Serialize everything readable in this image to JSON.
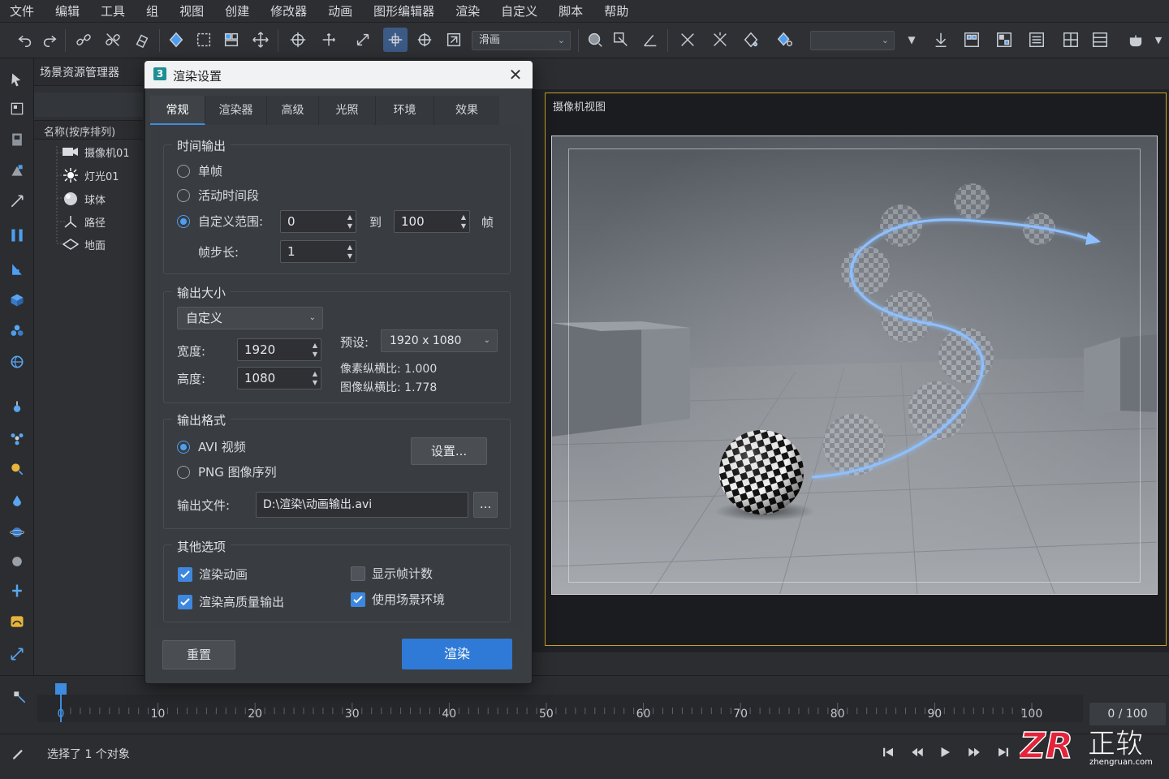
{
  "menu": [
    "文件",
    "编辑",
    "工具",
    "组",
    "视图",
    "创建",
    "修改器",
    "动画",
    "图形编辑器",
    "渲染",
    "自定义",
    "脚本",
    "帮助"
  ],
  "toolbar": {
    "mode_select": "滑画",
    "empty_select": ""
  },
  "scene_explorer": {
    "title": "场景资源管理器",
    "column_header": "名称(按序排列)",
    "items": [
      {
        "label": "摄像机01",
        "icon": "camera-icon"
      },
      {
        "label": "灯光01",
        "icon": "light-icon"
      },
      {
        "label": "球体",
        "icon": "sphere-icon"
      },
      {
        "label": "路径",
        "icon": "path-icon"
      },
      {
        "label": "地面",
        "icon": "plane-icon"
      }
    ]
  },
  "dialog": {
    "title": "渲染设置",
    "logo": "3",
    "close": "✕",
    "tabs": [
      "常规",
      "渲染器",
      "高级",
      "光照",
      "环境",
      "效果"
    ],
    "active_tab": "常规",
    "time_output": {
      "title": "时间输出",
      "single": "单帧",
      "active_segment": "活动时间段",
      "custom_range": "自定义范围:",
      "range_start": "0",
      "to": "到",
      "range_end": "100",
      "frames": "帧",
      "step_label": "帧步长:",
      "step_value": "1",
      "selected": "custom_range"
    },
    "output_size": {
      "title": "输出大小",
      "mode": "自定义",
      "width_label": "宽度:",
      "width": "1920",
      "height_label": "高度:",
      "height": "1080",
      "preset_label": "预设:",
      "preset": "1920 x 1080",
      "pixel_aspect": "像素纵横比: 1.000",
      "image_aspect": "图像纵横比: 1.778"
    },
    "output_format": {
      "title": "输出格式",
      "avi": "AVI 视频",
      "png": "PNG 图像序列",
      "settings_button": "设置...",
      "file_label": "输出文件:",
      "file_path": "D:\\渲染\\动画输出.avi",
      "browse": "...",
      "selected": "avi"
    },
    "other_options": {
      "title": "其他选项",
      "render_animation": {
        "label": "渲染动画",
        "checked": true
      },
      "high_quality": {
        "label": "渲染高质量输出",
        "checked": true
      },
      "show_frame_count": {
        "label": "显示帧计数",
        "checked": false
      },
      "use_scene_env": {
        "label": "使用场景环境",
        "checked": true
      }
    },
    "reset_button": "重置",
    "render_button": "渲染"
  },
  "viewport": {
    "label": "摄像机视图"
  },
  "timeline": {
    "labels": [
      "0",
      "10",
      "20",
      "30",
      "40",
      "50",
      "60",
      "70",
      "80",
      "90",
      "100"
    ],
    "current_frame": 0,
    "frame_display": "0 / 100"
  },
  "status": {
    "text": "选择了 1 个对象"
  },
  "watermark": {
    "brand": "ZR",
    "cn": "正软",
    "url": "zhengruan.com"
  },
  "colors": {
    "accent": "#2f7ad6",
    "viewport_border": "#c9a227",
    "path_glow": "#7fb6ff"
  }
}
